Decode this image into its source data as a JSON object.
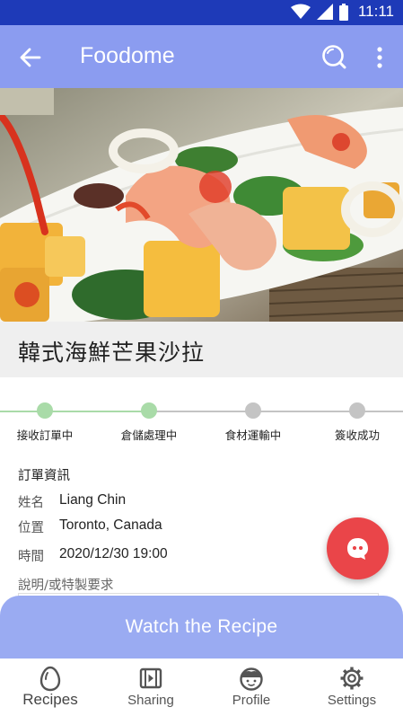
{
  "status_bar": {
    "time": "11:11"
  },
  "app_bar": {
    "title": "Foodome"
  },
  "dish": {
    "title": "韓式海鮮芒果沙拉"
  },
  "progress": {
    "steps": [
      {
        "label": "接收訂單中",
        "done": true
      },
      {
        "label": "倉儲處理中",
        "done": true
      },
      {
        "label": "食材運輸中",
        "done": false
      },
      {
        "label": "簽收成功",
        "done": false
      }
    ],
    "colors": {
      "done": "#a9dba8",
      "pending": "#c4c4c4"
    }
  },
  "order_info": {
    "heading": "訂單資訊",
    "name_label": "姓名",
    "name_value": "Liang Chin",
    "location_label": "位置",
    "location_value": "Toronto, Canada",
    "time_label": "時間",
    "time_value": "2020/12/30 19:00",
    "notes_label": "說明/或特製要求"
  },
  "watch_button": {
    "label": "Watch the Recipe"
  },
  "bottom_nav": {
    "items": [
      {
        "label": "Recipes",
        "icon": "egg-icon",
        "active": true
      },
      {
        "label": "Sharing",
        "icon": "video-icon",
        "active": false
      },
      {
        "label": "Profile",
        "icon": "face-icon",
        "active": false
      },
      {
        "label": "Settings",
        "icon": "gear-icon",
        "active": false
      }
    ]
  },
  "colors": {
    "status_bar": "#1e3ab8",
    "app_bar": "#8b9cf0",
    "watch_button": "#9aabf2",
    "fab": "#ea4549"
  }
}
